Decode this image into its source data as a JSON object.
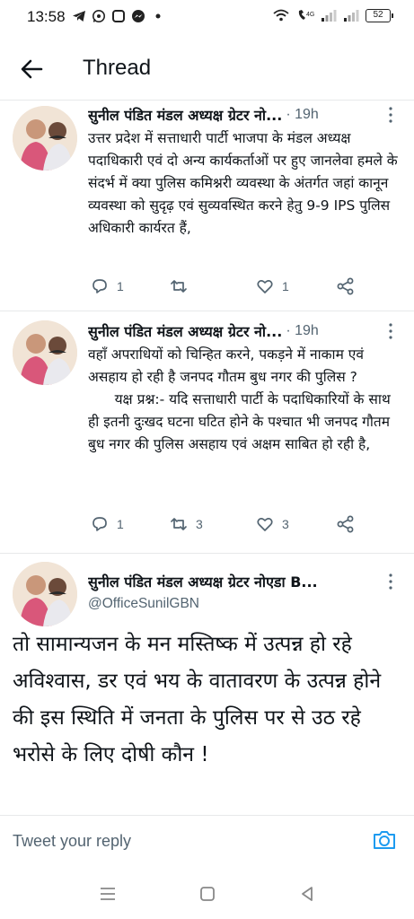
{
  "status_bar": {
    "time": "13:58",
    "battery": "52",
    "left_icons": [
      "telegram-icon",
      "whatsapp-icon",
      "app-square-icon",
      "messenger-icon",
      "dot-icon"
    ],
    "right_icons": [
      "wifi-icon",
      "volte-icon",
      "signal-icon",
      "signal-icon"
    ]
  },
  "header": {
    "title": "Thread",
    "back_icon": "arrow-left-icon"
  },
  "tweets": [
    {
      "author": "सुनील पंडित मंडल अध्यक्ष ग्रेटर नो...",
      "time": "· 19h",
      "text": "उत्तर प्रदेश में सत्ताधारी पार्टी भाजपा के मंडल अध्यक्ष पदाधिकारी एवं दो अन्य कार्यकर्ताओं पर हुए जानलेवा हमले के संदर्भ में क्या पुलिस कमिश्नरी व्यवस्था के अंतर्गत जहां कानून व्यवस्था को सुदृढ़ एवं सुव्यवस्थित करने हेतु 9-9 IPS पुलिस अधिकारी कार्यरत हैं,",
      "reply_count": "1",
      "retweet_count": "",
      "like_count": "1"
    },
    {
      "author": "सुनील पंडित मंडल अध्यक्ष ग्रेटर नो...",
      "time": "· 19h",
      "text": "वहाँ अपराधियों को चिन्हित करने, पकड़ने में नाकाम एवं असहाय हो रही है जनपद गौतम बुध नगर की पुलिस ?\n      यक्ष प्रश्न:- यदि सत्ताधारी पार्टी के पदाधिकारियों के साथ ही इतनी दुःखद घटना घटित होने के पश्चात भी जनपद गौतम बुध नगर की पुलिस असहाय एवं अक्षम साबित हो रही है,",
      "reply_count": "1",
      "retweet_count": "3",
      "like_count": "3"
    }
  ],
  "main_tweet": {
    "author": "सुनील पंडित मंडल अध्यक्ष ग्रेटर नोएडा B...",
    "handle": "@OfficeSunilGBN",
    "text": "तो सामान्यजन के मन मस्तिष्क में उत्पन्न हो रहे अविश्वास, डर एवं भय के वातावरण के उत्पन्न होने की इस स्थिति में जनता के पुलिस पर से उठ रहे भरोसे के लिए दोषी कौन !"
  },
  "reply_bar": {
    "placeholder": "Tweet your reply",
    "camera_icon": "camera-icon"
  },
  "nav_bar": {
    "icons": [
      "menu-icon",
      "home-icon",
      "back-icon"
    ]
  },
  "colors": {
    "accent": "#1d9bf0",
    "secondary_text": "#536471",
    "divider": "#e7e9ea"
  }
}
